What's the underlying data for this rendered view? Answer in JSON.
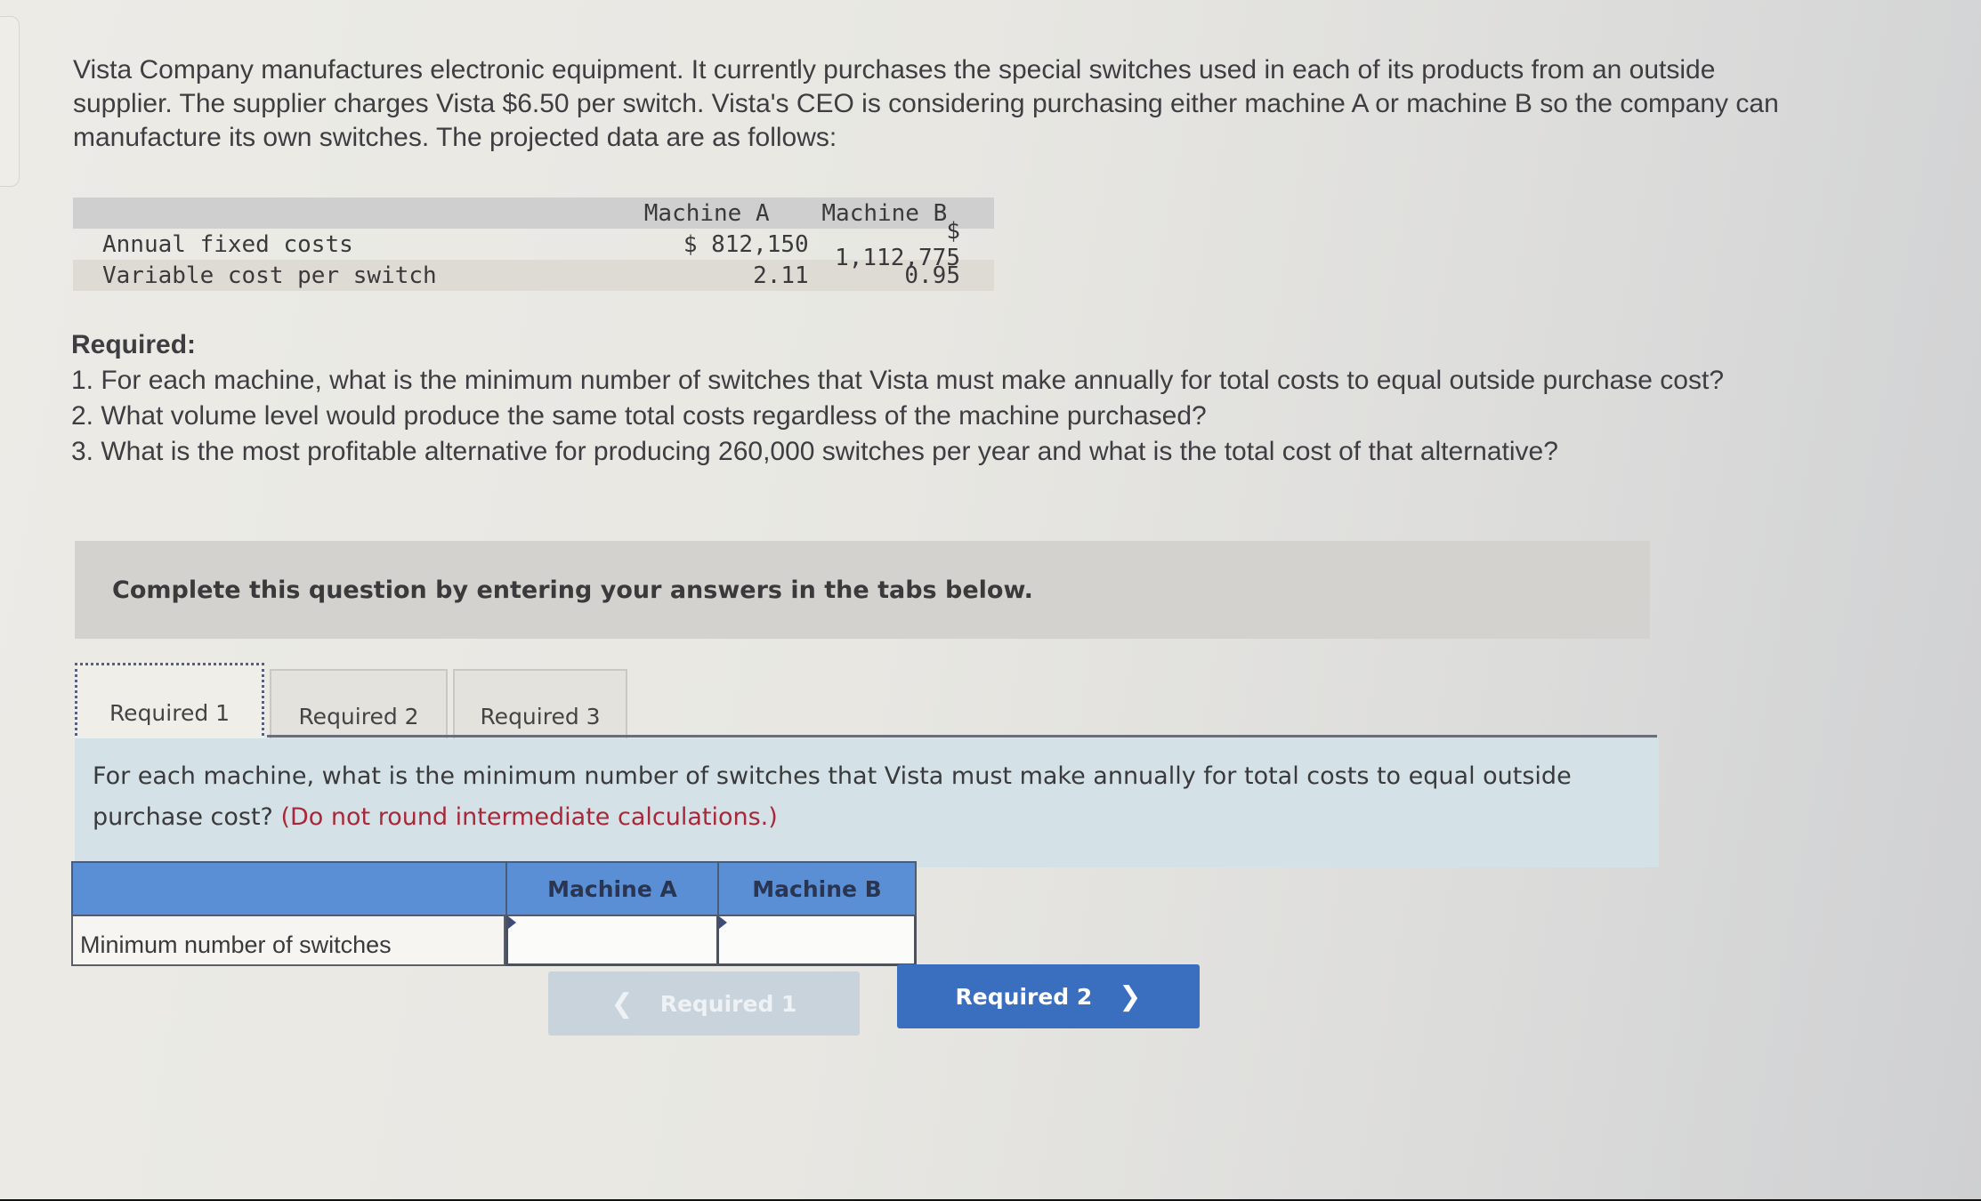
{
  "intro": "Vista Company manufactures electronic equipment. It currently purchases the special switches used in each of its products from an outside supplier. The supplier charges Vista $6.50 per switch. Vista's CEO is considering purchasing either machine A or machine B so the company can manufacture its own switches. The projected data are as follows:",
  "data_table": {
    "headers": [
      "",
      "Machine A",
      "Machine B"
    ],
    "rows": [
      {
        "label": "Annual fixed costs",
        "a": "$ 812,150",
        "b": "$ 1,112,775"
      },
      {
        "label": "Variable cost per switch",
        "a": "2.11",
        "b": "0.95"
      }
    ]
  },
  "required": {
    "title": "Required:",
    "items": [
      "1. For each machine, what is the minimum number of switches that Vista must make annually for total costs to equal outside purchase cost?",
      "2. What volume level would produce the same total costs regardless of the machine purchased?",
      "3. What is the most profitable alternative for producing 260,000 switches per year and what is the total cost of that alternative?"
    ]
  },
  "banner": "Complete this question by entering your answers in the tabs below.",
  "tabs": [
    {
      "label": "Required 1",
      "active": true
    },
    {
      "label": "Required 2",
      "active": false
    },
    {
      "label": "Required 3",
      "active": false
    }
  ],
  "prompt": {
    "text": "For each machine, what is the minimum number of switches that Vista must make annually for total costs to equal outside purchase cost?",
    "note": "(Do not round intermediate calculations.)"
  },
  "answer_table": {
    "headers": [
      "",
      "Machine A",
      "Machine B"
    ],
    "row_label": "Minimum number of switches",
    "values": {
      "a": "",
      "b": ""
    }
  },
  "nav": {
    "prev_label": "Required 1",
    "next_label": "Required 2",
    "prev_icon": "chevron-left-icon",
    "next_icon": "chevron-right-icon"
  },
  "colors": {
    "header_blue": "#5a8fd6",
    "next_button": "#3a6fbf",
    "note_red": "#a8283a",
    "prompt_bg": "#d4e1e6"
  }
}
